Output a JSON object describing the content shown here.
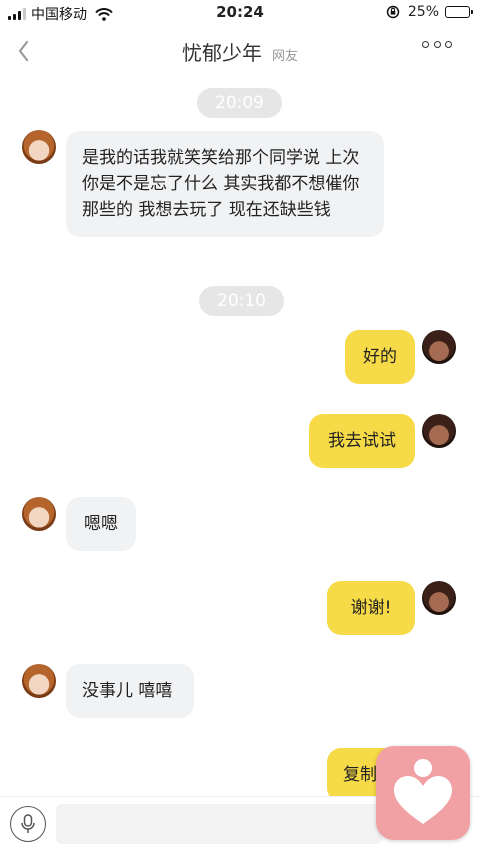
{
  "status_bar": {
    "carrier": "中国移动",
    "time": "20:24",
    "battery_percent": "25%",
    "battery_level": 0.25,
    "battery_color": "#f2c417"
  },
  "nav": {
    "back_icon": "chevron-left-icon",
    "title": "忧郁少年",
    "subtitle": "网友",
    "more_icon": "more-dots-icon"
  },
  "chat": {
    "timestamps": [
      "20:09",
      "20:10"
    ],
    "messages": [
      {
        "side": "in",
        "text": "是我的话我就笑笑给那个同学说 上次你是不是忘了什么 其实我都不想催你那些的 我想去玩了 现在还缺些钱"
      },
      {
        "side": "out",
        "text": "好的"
      },
      {
        "side": "out",
        "text": "我去试试"
      },
      {
        "side": "in",
        "text": "嗯嗯"
      },
      {
        "side": "out",
        "text": "谢谢!"
      },
      {
        "side": "in",
        "text": "没事儿 嘻嘻"
      },
      {
        "side": "out",
        "text": "复制"
      }
    ],
    "in_bubble_color": "#f1f2f4",
    "out_bubble_color": "#f7da47"
  },
  "input_bar": {
    "mic_icon": "microphone-icon",
    "placeholder": ""
  },
  "floating_app": {
    "icon": "heart-person-icon",
    "color": "#f1a1a3"
  }
}
